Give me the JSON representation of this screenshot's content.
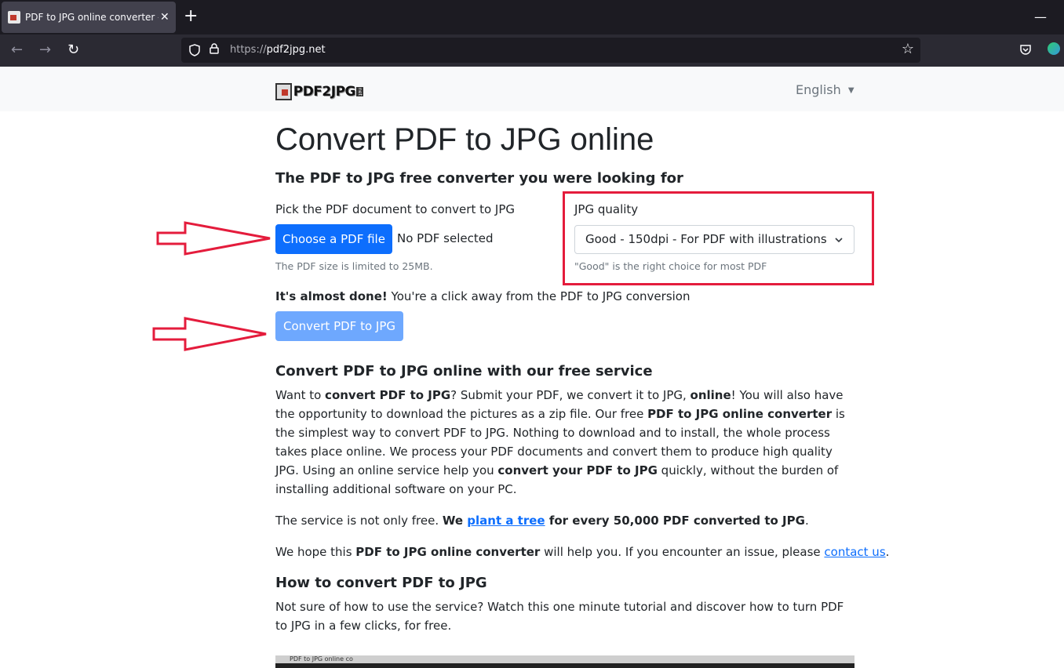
{
  "browser": {
    "tab_title": "PDF to JPG online converter - Co",
    "tab_close": "✕",
    "new_tab": "+",
    "minimize": "—",
    "url_scheme": "https://",
    "url_host": "pdf2jpg.net"
  },
  "header": {
    "logo_text": "PDF2JPG",
    "logo_tld": "net",
    "language": "English"
  },
  "main": {
    "title": "Convert PDF to JPG online",
    "subtitle": "The PDF to JPG free converter you were looking for",
    "pick_label": "Pick the PDF document to convert to JPG",
    "choose_button": "Choose a PDF file",
    "no_file": "No PDF selected",
    "size_help": "The PDF size is limited to 25MB.",
    "quality_label": "JPG quality",
    "quality_value": "Good - 150dpi - For PDF with illustrations",
    "quality_help": "\"Good\" is the right choice for most PDF",
    "almost_bold": "It's almost done!",
    "almost_rest": " You're a click away from the PDF to JPG conversion",
    "convert_button": "Convert PDF to JPG"
  },
  "article": {
    "service_heading": "Convert PDF to JPG online with our free service",
    "p1": [
      {
        "t": "Want to "
      },
      {
        "t": "convert PDF to JPG",
        "b": true
      },
      {
        "t": "? Submit your PDF, we convert it to JPG, "
      },
      {
        "t": "online",
        "b": true
      },
      {
        "t": "! You will also have the opportunity to download the pictures as a zip file. Our free "
      },
      {
        "t": "PDF to JPG online converter",
        "b": true
      },
      {
        "t": " is the simplest way to convert PDF to JPG. Nothing to download and to install, the whole process takes place online. We process your PDF documents and convert them to produce high quality JPG. Using an online service help you "
      },
      {
        "t": "convert your PDF to JPG",
        "b": true
      },
      {
        "t": " quickly, without the burden of installing additional software on your PC."
      }
    ],
    "p2_a": "The service is not only free. ",
    "p2_b": "We ",
    "p2_link": "plant a tree",
    "p2_c": " for every 50,000 PDF converted to JPG",
    "p2_d": ".",
    "p3_a": "We hope this ",
    "p3_b": "PDF to JPG online converter",
    "p3_c": " will help you. If you encounter an issue, please ",
    "p3_link": "contact us",
    "p3_d": ".",
    "how_heading": "How to convert PDF to JPG",
    "p4": "Not sure of how to use the service? Watch this one minute tutorial and discover how to turn PDF to JPG in a few clicks, for free.",
    "video_title": "PDF to JPG online co"
  },
  "colors": {
    "annotation_red": "#e41c3c",
    "primary_blue": "#0d6efd",
    "disabled_blue": "#6ea8fe"
  }
}
